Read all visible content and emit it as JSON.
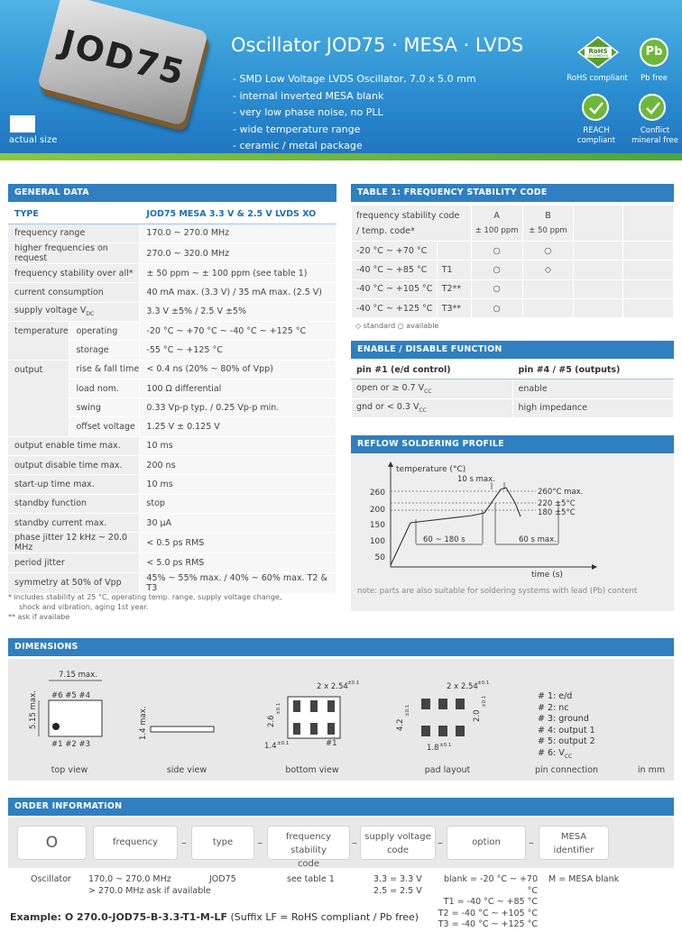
{
  "header": {
    "chip_marking": "JOD75",
    "actual_size_label": "actual size",
    "title": "Oscillator JOD75 · MESA · LVDS",
    "features": [
      "- SMD Low Voltage LVDS Oscillator, 7.0 x 5.0 mm",
      "- internal inverted MESA blank",
      "- very low phase noise, no PLL",
      "- wide temperature range",
      "- ceramic / metal package"
    ],
    "certs": {
      "rohs_badge": "RoHS",
      "rohs_badge_sub": "2015/863/EU",
      "rohs_label": "RoHS compliant",
      "pb_badge": "Pb",
      "pb_label": "Pb free",
      "reach_label1": "REACH",
      "reach_label2": "compliant",
      "conflict_label1": "Conflict",
      "conflict_label2": "mineral free"
    },
    "colors": {
      "accent": "#2f7fc1",
      "green": "#6fb73a"
    }
  },
  "general_data": {
    "section_title": "GENERAL DATA",
    "type_label": "TYPE",
    "type_value": "JOD75 MESA 3.3 V & 2.5 V LVDS XO",
    "rows": [
      {
        "label": "frequency range",
        "value": "170.0 ~ 270.0 MHz"
      },
      {
        "label": "higher frequencies on request",
        "value": "270.0 ~ 320.0 MHz"
      },
      {
        "label": "frequency stability over all*",
        "value": "± 50 ppm ~ ± 100 ppm (see table 1)"
      },
      {
        "label": "current consumption",
        "value": "40 mA max. (3.3 V) / 35 mA max. (2.5 V)"
      },
      {
        "label": "supply voltage V",
        "label_sub": "DC",
        "value": "3.3 V ±5% / 2.5 V ±5%"
      }
    ],
    "temperature": {
      "label": "temperature",
      "operating_label": "operating",
      "operating_value": "-20 °C ~ +70 °C ~ -40 °C ~ +125 °C",
      "storage_label": "storage",
      "storage_value": "-55 °C ~ +125 °C"
    },
    "output": {
      "label": "output",
      "rows": [
        {
          "label": "rise & fall time",
          "value": "< 0.4 ns (20% ~ 80% of Vpp)"
        },
        {
          "label": "load nom.",
          "value": "100 Ω differential"
        },
        {
          "label": "swing",
          "value": "0.33 Vp-p typ. / 0.25 Vp-p min."
        },
        {
          "label": "offset voltage",
          "value": "1.25 V ± 0.125 V"
        }
      ]
    },
    "rows2": [
      {
        "label": "output enable time max.",
        "value": "10 ms"
      },
      {
        "label": "output disable time max.",
        "value": "200 ns"
      },
      {
        "label": "start-up time max.",
        "value": "10 ms"
      },
      {
        "label": "standby function",
        "value": "stop"
      },
      {
        "label": "standby current max.",
        "value": "30 µA"
      },
      {
        "label": "phase jitter 12 kHz ~ 20.0 MHz",
        "value": "< 0.5 ps RMS"
      },
      {
        "label": "period jitter",
        "value": "< 5.0 ps RMS"
      },
      {
        "label": "symmetry at 50% of Vpp",
        "value": "45% ~ 55% max. / 40% ~ 60% max. T2 & T3"
      }
    ],
    "footnote1": "*   includes stability at 25 °C, operating temp. range, supply voltage change,",
    "footnote1b": "shock and vibration, aging 1st year.",
    "footnote2": "** ask if availabe"
  },
  "freq_table": {
    "section_title": "TABLE 1: FREQUENCY STABILITY CODE",
    "head_label1": "frequency stability code",
    "head_label2": "/ temp. code*",
    "col_a": "A",
    "col_a_sub": "± 100 ppm",
    "col_b": "B",
    "col_b_sub": "± 50 ppm",
    "rows": [
      {
        "range": "-20 °C ~   +70 °C",
        "code": "",
        "a": "○",
        "b": "○"
      },
      {
        "range": "-40 °C ~   +85 °C",
        "code": "T1",
        "a": "○",
        "b": "◇"
      },
      {
        "range": "-40 °C ~ +105 °C",
        "code": "T2**",
        "a": "○",
        "b": ""
      },
      {
        "range": "-40 °C ~ +125 °C",
        "code": "T3**",
        "a": "○",
        "b": ""
      }
    ],
    "legend": "◇ standard   ○ available"
  },
  "enable": {
    "section_title": "ENABLE / DISABLE FUNCTION",
    "col1": "pin #1 (e/d control)",
    "col2": "pin #4 / #5 (outputs)",
    "row1_pin": "open or ≥ 0.7 V",
    "row1_sub": "CC",
    "row1_out": "enable",
    "row2_pin": "gnd or < 0.3 V",
    "row2_sub": "CC",
    "row2_out": "high impedance"
  },
  "reflow": {
    "section_title": "REFLOW SOLDERING PROFILE",
    "ylabel": "temperature (°C)",
    "xlabel": "time (s)",
    "yticks": [
      "260",
      "200",
      "150",
      "100",
      "50"
    ],
    "ann_10s": "10 s max.",
    "ann_260": "260°C max.",
    "ann_220": "220 ±5°C",
    "ann_180": "180 ±5°C",
    "ann_60_180": "60 ~ 180 s",
    "ann_60s": "60 s max.",
    "note": "note: parts are also suitable for soldering systems with lead (Pb) content"
  },
  "dimensions": {
    "section_title": "DIMENSIONS",
    "top_w": "7.15 max.",
    "top_h": "5.15 max.",
    "pins_top": "#6  #5  #4",
    "pins_bot": "#1  #2  #3",
    "side_h": "1.4 max.",
    "bottom_pitch": "2 x 2.54",
    "bottom_pitch_tol": "±0.1",
    "bottom_26": "2.6",
    "bottom_26_tol": "±0.1",
    "bottom_14": "1.4",
    "bottom_14_tol": "±0.1",
    "bottom_pin": "#1",
    "pad_pitch": "2 x 2.54",
    "pad_pitch_tol": "±0.1",
    "pad_42": "4.2",
    "pad_42_tol": "±0.1",
    "pad_20": "2.0",
    "pad_20_tol": "±0.1",
    "pad_18": "1.8",
    "pad_18_tol": "±0.1",
    "pin_conn": [
      "# 1: e/d",
      "# 2: nc",
      "# 3: ground",
      "# 4: output 1",
      "# 5: output 2",
      "# 6: V"
    ],
    "pin6_sub": "CC",
    "labels": {
      "top": "top view",
      "side": "side view",
      "bottom": "bottom view",
      "pad": "pad layout",
      "pins": "pin connection",
      "unit": "in mm"
    }
  },
  "order": {
    "section_title": "ORDER INFORMATION",
    "boxes": {
      "oscillator": "O",
      "frequency": "frequency",
      "type": "type",
      "stability1": "frequency stability",
      "stability2": "code",
      "supply1": "supply voltage",
      "supply2": "code",
      "option": "option",
      "mesa1": "MESA",
      "mesa2": "identifier"
    },
    "sub": {
      "oscillator": "Oscillator",
      "freq1": "170.0 ~ 270.0 MHz",
      "freq2": "> 270.0 MHz ask if available",
      "type": "JOD75",
      "stability": "see table 1",
      "supply1": "3.3 = 3.3 V",
      "supply2": "2.5 = 2.5 V",
      "option1": "blank = -20 °C ~  +70 °C",
      "option2": "T1 = -40 °C ~  +85 °C",
      "option3": "T2 = -40 °C ~ +105 °C",
      "option4": "T3 = -40 °C ~ +125 °C",
      "mesa": "M = MESA blank"
    },
    "example_bold": "Example: O 270.0-JOD75-B-3.3-T1-M-LF",
    "example_rest": "(Suffix LF = RoHS compliant / Pb free)"
  }
}
